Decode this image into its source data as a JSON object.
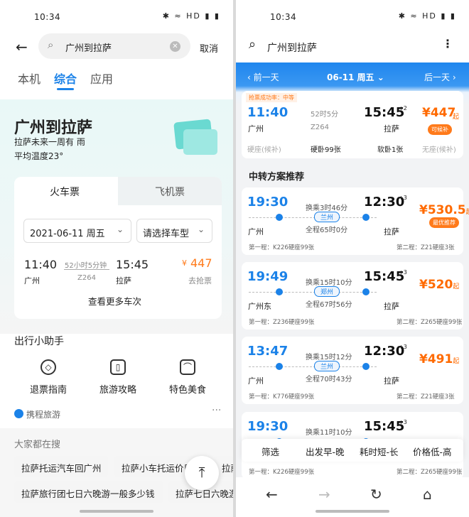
{
  "status": {
    "time": "10:34",
    "icons": "✱ ≈ HD ▮ ▮"
  },
  "left": {
    "search": {
      "query": "广州到拉萨",
      "cancel": "取消"
    },
    "tabs": [
      {
        "label": "本机"
      },
      {
        "label": "综合"
      },
      {
        "label": "应用"
      }
    ],
    "dest": {
      "title": "广州到拉萨",
      "weather": "拉萨未来一周有 雨",
      "temp": "平均温度23°"
    },
    "ticket_tabs": {
      "train": "火车票",
      "flight": "飞机票"
    },
    "date": "2021-06-11 周五",
    "type": "请选择车型",
    "train": {
      "dep_time": "11:40",
      "dep_station": "广州",
      "duration": "52小时5分钟",
      "number": "Z264",
      "arr_time": "15:45",
      "arr_station": "拉萨",
      "price": "447",
      "status": "去抢票"
    },
    "more": "查看更多车次",
    "helper_title": "出行小助手",
    "tools": [
      {
        "label": "退票指南",
        "icon": "compass-icon"
      },
      {
        "label": "旅游攻略",
        "icon": "bookmark-icon"
      },
      {
        "label": "特色美食",
        "icon": "food-icon"
      }
    ],
    "source": "携程旅游",
    "hot_title": "大家都在搜",
    "hot": [
      "拉萨托运汽车回广州",
      "拉萨小车托运价目",
      "拉萨",
      "拉萨旅行团七日六晚游一般多少钱",
      "拉萨七日六晚游"
    ]
  },
  "right": {
    "search": {
      "query": "广州到拉萨"
    },
    "date_bar": {
      "prev": "前一天",
      "date": "06-11 周五",
      "next": "后一天"
    },
    "direct": {
      "tag": "抢票成功率：中等",
      "dep_time": "11:40",
      "dep_station": "广州",
      "duration": "52时5分",
      "number": "Z264",
      "arr_time": "15:45",
      "plus": "+2",
      "arr_station": "拉萨",
      "price": "447",
      "price_suffix": "起",
      "badge": "可候补",
      "seats": [
        {
          "label": "硬座(候补)"
        },
        {
          "label": "硬卧99张"
        },
        {
          "label": "软卧1张"
        },
        {
          "label": "无座(候补)"
        }
      ]
    },
    "transfer_title": "中转方案推荐",
    "transfers": [
      {
        "dep_time": "19:30",
        "dep_station": "广州",
        "wait": "换乘3时46分",
        "via": "兰州",
        "total": "全程65时0分",
        "arr_time": "12:30",
        "plus": "+3",
        "arr_station": "拉萨",
        "price": "530.5",
        "price_suffix": "起",
        "badge": "最优推荐",
        "leg1": "第一程：K226硬座99张",
        "leg2": "第二程：Z21硬座3张"
      },
      {
        "dep_time": "19:49",
        "dep_station": "广州东",
        "wait": "换乘15时10分",
        "via": "郑州",
        "total": "全程67时56分",
        "arr_time": "15:45",
        "plus": "+3",
        "arr_station": "拉萨",
        "price": "520",
        "price_suffix": "起",
        "badge": "",
        "leg1": "第一程：Z236硬座99张",
        "leg2": "第二程：Z265硬座99张"
      },
      {
        "dep_time": "13:47",
        "dep_station": "广州",
        "wait": "换乘15时12分",
        "via": "兰州",
        "total": "全程70时43分",
        "arr_time": "12:30",
        "plus": "+3",
        "arr_station": "拉萨",
        "price": "491",
        "price_suffix": "起",
        "badge": "",
        "leg1": "第一程：K776硬座99张",
        "leg2": "第二程：Z21硬座3张"
      },
      {
        "dep_time": "19:30",
        "dep_station": "",
        "wait": "换乘11时10分",
        "via": "",
        "total": "",
        "arr_time": "15:45",
        "plus": "+3",
        "arr_station": "",
        "price": "",
        "price_suffix": "",
        "badge": "",
        "leg1": "第一程：K226硬座99张",
        "leg2": "第二程：Z265硬座99张"
      }
    ],
    "filters": [
      {
        "label": "筛选"
      },
      {
        "label": "出发早-晚"
      },
      {
        "label": "耗时短-长"
      },
      {
        "label": "价格低-高"
      }
    ]
  }
}
